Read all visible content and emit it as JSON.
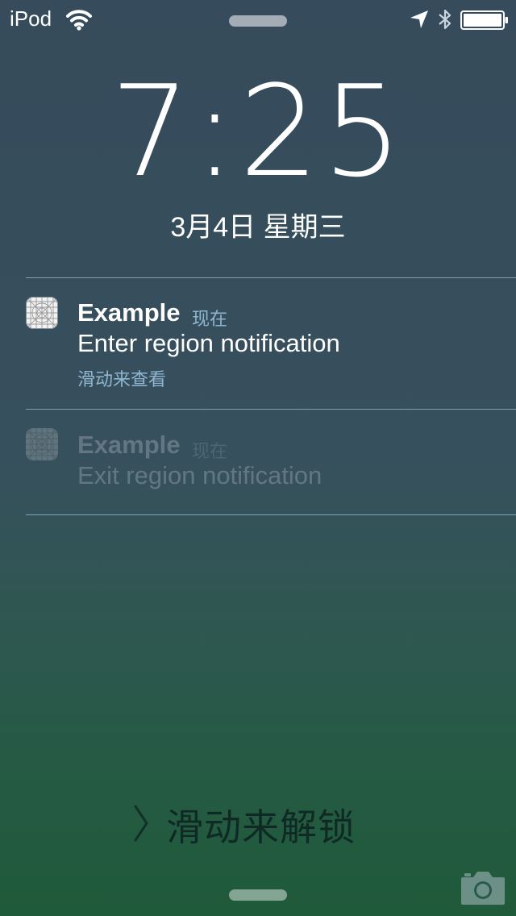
{
  "status_bar": {
    "carrier": "iPod",
    "icons": [
      "wifi-icon",
      "location-icon",
      "bluetooth-icon",
      "battery-icon"
    ],
    "battery_level": 1.0
  },
  "lock_screen": {
    "time": "7:25",
    "date": "3月4日 星期三"
  },
  "notifications": [
    {
      "app": "Example",
      "time": "现在",
      "body": "Enter region notification",
      "action": "滑动来查看",
      "icon": "app-icon"
    },
    {
      "app": "Example",
      "time": "现在",
      "body": "Exit region notification",
      "icon": "app-icon"
    }
  ],
  "unlock": {
    "label": "滑动来解锁",
    "icon": "chevron-right-icon"
  },
  "bottom_icons": [
    "camera-icon"
  ],
  "colors": {
    "accent_secondary_text": "#8fb6cf",
    "divider": "#96bed7",
    "gradient_top": "#364b5b",
    "gradient_bottom": "#1f5a3a"
  }
}
